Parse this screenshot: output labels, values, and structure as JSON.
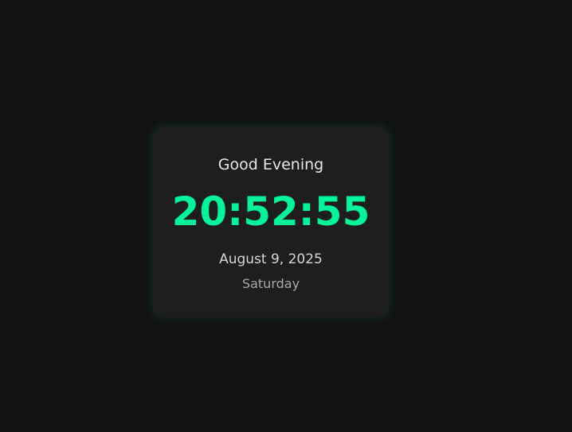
{
  "clock": {
    "greeting": "Good Evening",
    "time": "20:52:55",
    "date": "August 9, 2025",
    "day": "Saturday"
  },
  "colors": {
    "background": "#121212",
    "card": "#1e1e1e",
    "accent": "#00f59a"
  }
}
